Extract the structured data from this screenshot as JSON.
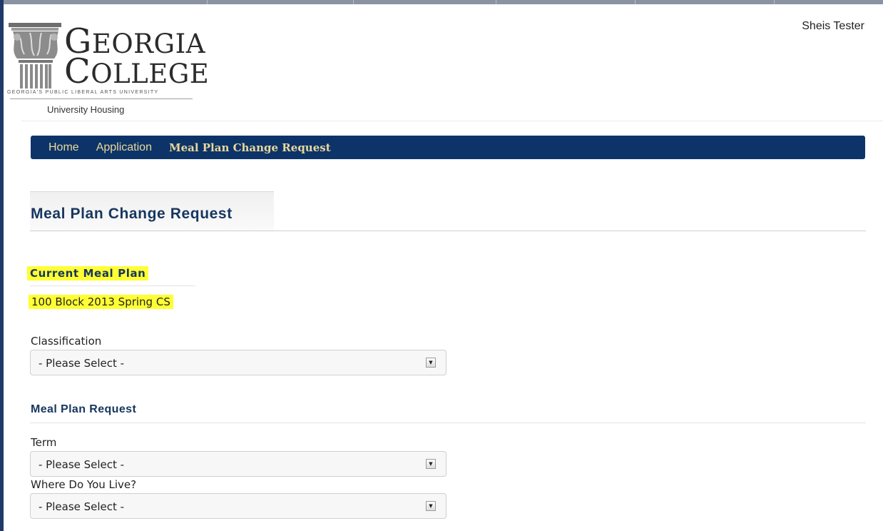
{
  "header": {
    "logo_word_1": "GEORGIA",
    "logo_word_1_cap": "G",
    "logo_word_1_rest": "EORGIA",
    "logo_word_2_cap": "C",
    "logo_word_2_rest": "OLLEGE",
    "logo_tagline": "GEORGIA'S PUBLIC LIBERAL ARTS UNIVERSITY",
    "logo_sub": "University Housing",
    "user_name": "Sheis Tester"
  },
  "nav": {
    "items": [
      {
        "label": "Home"
      },
      {
        "label": "Application"
      },
      {
        "label": "Meal Plan Change Request"
      }
    ]
  },
  "page": {
    "title": "Meal Plan Change Request"
  },
  "current_plan": {
    "label": "Current Meal Plan",
    "value": "100 Block 2013 Spring CS"
  },
  "form": {
    "classification": {
      "label": "Classification",
      "value": "- Please Select -"
    },
    "section_title": "Meal Plan Request",
    "term": {
      "label": "Term",
      "value": "- Please Select -"
    },
    "residence": {
      "label": "Where Do You Live?",
      "value": "- Please Select -"
    }
  },
  "colors": {
    "nav_bg": "#0d3468",
    "nav_text": "#e9d89b",
    "heading": "#16365f",
    "highlight": "#ffff33"
  },
  "icons": {
    "select_arrow": "chevron-down-icon",
    "logo": "column-capital-icon"
  }
}
